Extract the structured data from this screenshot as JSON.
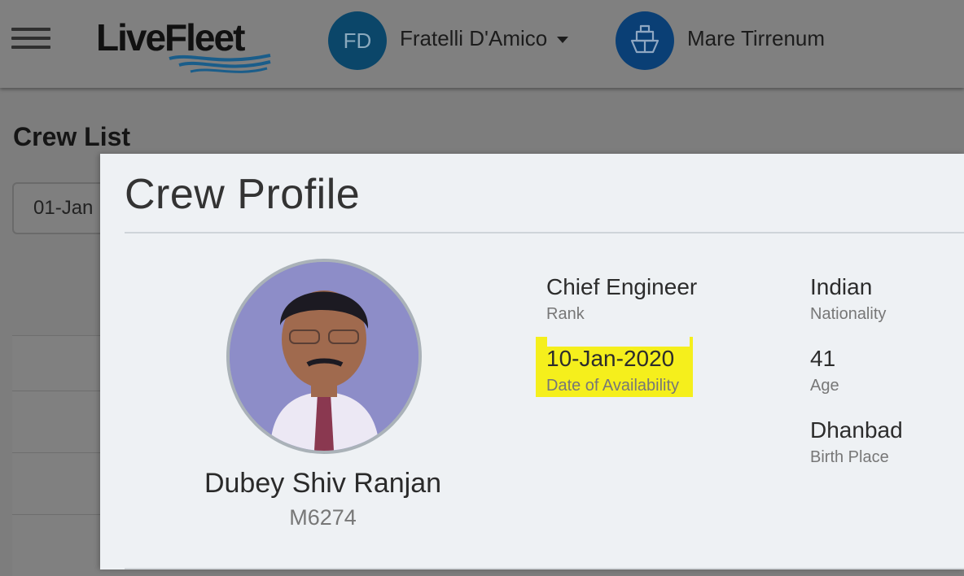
{
  "app": {
    "logo_text": "LiveFleet"
  },
  "header": {
    "company_initials": "FD",
    "company_name": "Fratelli D'Amico",
    "vessel_name": "Mare Tirrenum"
  },
  "page": {
    "title": "Crew List",
    "date_filter_value": "01-Jan"
  },
  "modal": {
    "title": "Crew Profile",
    "name": "Dubey Shiv Ranjan",
    "crew_id": "M6274",
    "fields": {
      "rank": {
        "value": "Chief Engineer",
        "label": "Rank"
      },
      "availability": {
        "value": "10-Jan-2020",
        "label": "Date of Availability"
      },
      "nationality": {
        "value": "Indian",
        "label": "Nationality"
      },
      "age": {
        "value": "41",
        "label": "Age"
      },
      "birth_place": {
        "value": "Dhanbad",
        "label": "Birth Place"
      }
    }
  },
  "colors": {
    "highlight": "#f5ef1c",
    "company_avatar": "#0b4669",
    "vessel_avatar": "#0a3f75",
    "modal_bg": "#eef1f4"
  },
  "icons": [
    "menu-icon",
    "ship-icon",
    "chevron-down-icon"
  ]
}
